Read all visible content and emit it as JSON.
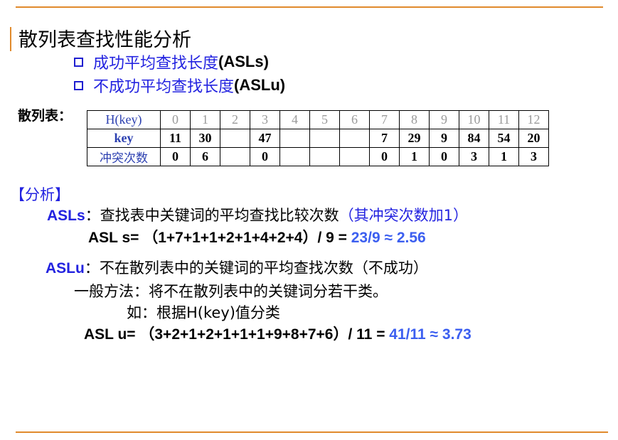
{
  "slide": {
    "title": "散列表查找性能分析",
    "bullets": [
      {
        "text": "成功平均查找长度",
        "suffix": "(ASLs)"
      },
      {
        "text": "不成功平均查找长度 ",
        "suffix": "(ASLu)"
      }
    ]
  },
  "table": {
    "label": "散列表：",
    "row_headers": [
      "H(key)",
      "key",
      "冲突次数"
    ],
    "h_values": [
      "0",
      "1",
      "2",
      "3",
      "4",
      "5",
      "6",
      "7",
      "8",
      "9",
      "10",
      "11",
      "12"
    ],
    "keys": [
      "11",
      "30",
      "",
      "47",
      "",
      "",
      "",
      "7",
      "29",
      "9",
      "84",
      "54",
      "20"
    ],
    "conflicts": [
      "0",
      "6",
      "",
      "0",
      "",
      "",
      "",
      "0",
      "1",
      "0",
      "3",
      "1",
      "3"
    ]
  },
  "analysis": {
    "heading": "【分析】",
    "asls_label": "ASLs",
    "asls_desc": "：查找表中关键词的平均查找比较次数",
    "asls_note": "（其冲突次数加1）",
    "asls_formula_prefix": "ASL s= （1+7+1+1+2+1+4+2+4）/ 9 = ",
    "asls_result": "23/9 ≈ 2.56",
    "aslu_label": "ASLu",
    "aslu_desc": "：不在散列表中的关键词的平均查找次数（不成功）",
    "method": "一般方法：将不在散列表中的关键词分若干类。",
    "example": "如：根据H(key)值分类",
    "aslu_formula_prefix": "ASL u= （3+2+1+2+1+1+1+9+8+7+6）/ 11 = ",
    "aslu_result": "41/11 ≈ 3.73"
  },
  "colors": {
    "accent": "#e08a2c",
    "blue": "#2323e0",
    "result_blue": "#3c5ff0"
  }
}
